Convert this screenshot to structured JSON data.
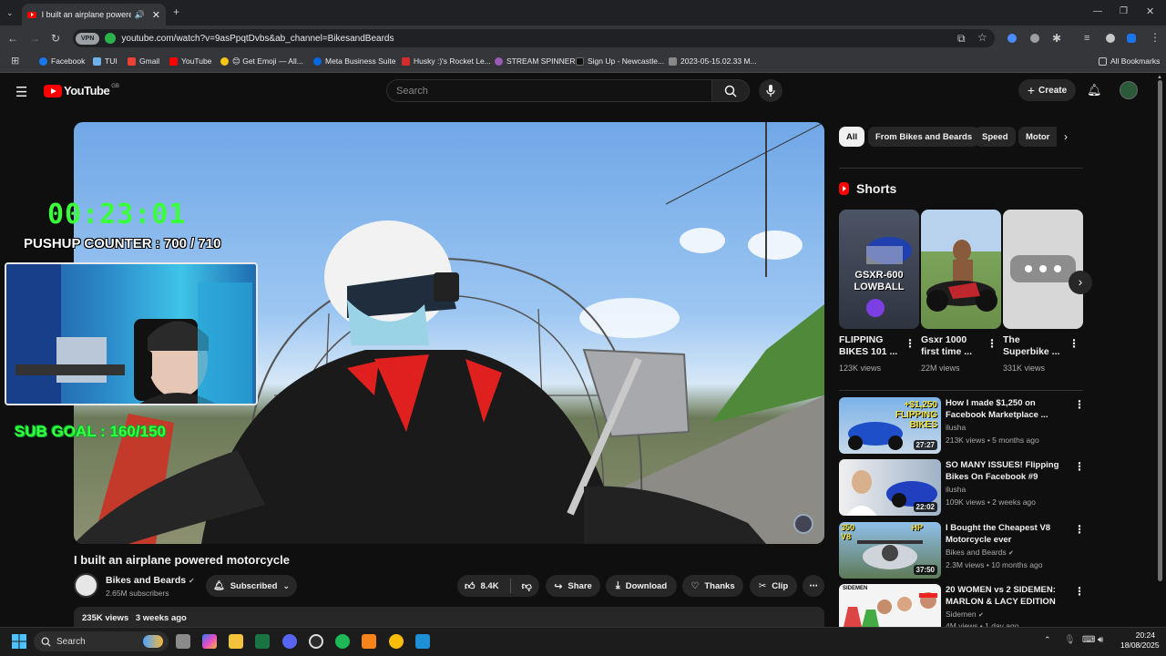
{
  "browser": {
    "tab_title": "I built an airplane powered",
    "url": "youtube.com/watch?v=9asPpqtDvbs&ab_channel=BikesandBeards",
    "vpn_label": "VPN",
    "bookmarks": [
      {
        "label": "Facebook",
        "color": "#1877f2"
      },
      {
        "label": "TUI",
        "color": "#6cb2e8"
      },
      {
        "label": "Gmail",
        "color": "#ea4335"
      },
      {
        "label": "YouTube",
        "color": "#ff0000"
      },
      {
        "label": "😊 Get Emoji — All...",
        "color": "#f5c518"
      },
      {
        "label": "Meta Business Suite",
        "color": "#0668e1"
      },
      {
        "label": "Husky :)'s Rocket Le...",
        "color": "#d62c2c"
      },
      {
        "label": "STREAM SPINNER",
        "color": "#9b59b6"
      },
      {
        "label": "Sign Up - Newcastle...",
        "color": "#111111"
      },
      {
        "label": "2023-05-15.02.33 M...",
        "color": "#888888"
      }
    ],
    "all_bookmarks": "All Bookmarks"
  },
  "header": {
    "logo_text": "YouTube",
    "region": "GB",
    "search_placeholder": "Search",
    "create_label": "Create"
  },
  "overlay": {
    "timer": "00:23:01",
    "pushup": "PUSHUP COUNTER : 700 / 710",
    "subgoal": "SUB GOAL : 160/150"
  },
  "video": {
    "title": "I built an airplane powered motorcycle",
    "channel": "Bikes and Beards",
    "subscribers": "2.65M subscribers",
    "subscribed_label": "Subscribed",
    "likes": "8.4K",
    "share": "Share",
    "download": "Download",
    "thanks": "Thanks",
    "clip": "Clip",
    "views": "235K views",
    "age": "3 weeks ago"
  },
  "chips": [
    "All",
    "From Bikes and Beards",
    "Speed",
    "Motor"
  ],
  "shorts": {
    "heading": "Shorts",
    "items": [
      {
        "title": "FLIPPING BIKES 101 ...",
        "views": "123K views",
        "thumb_text": "GSXR-600 LOWBALL"
      },
      {
        "title": "Gsxr 1000 first time ...",
        "views": "22M views"
      },
      {
        "title": "The Superbike ...",
        "views": "331K views"
      }
    ]
  },
  "recommended": [
    {
      "title": "How I made $1,250 on Facebook Marketplace ...",
      "channel": "ilusha",
      "meta": "213K views • 5 months ago",
      "duration": "27:27",
      "thumb_text": "+$1,250 FLIPPING BIKES",
      "verified": false
    },
    {
      "title": "SO MANY ISSUES! Flipping Bikes On Facebook #9",
      "channel": "ilusha",
      "meta": "109K views • 2 weeks ago",
      "duration": "22:02",
      "verified": false
    },
    {
      "title": "I Bought the Cheapest V8 Motorcycle ever",
      "channel": "Bikes and Beards",
      "meta": "2.3M views • 10 months ago",
      "duration": "37:50",
      "thumb_text": "350 HP V8",
      "verified": true
    },
    {
      "title": "20 WOMEN vs 2 SIDEMEN: MARLON & LACY EDITION",
      "channel": "Sidemen",
      "meta": "4M views • 1 day ago",
      "duration": "",
      "thumb_text": "SIDEMEN",
      "verified": true
    }
  ],
  "taskbar": {
    "search": "Search",
    "time": "20:24",
    "date": "18/08/2025"
  },
  "colors": {
    "accent_red": "#ff0000",
    "overlay_green": "#3bff3b",
    "bg": "#0f0f0f"
  }
}
